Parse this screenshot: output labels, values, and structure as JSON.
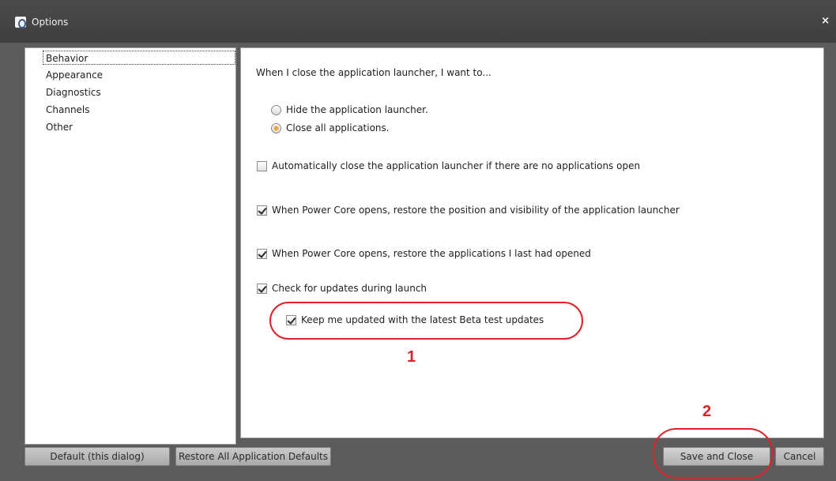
{
  "window": {
    "title": "Options",
    "close_glyph": "×",
    "icon": "app-icon"
  },
  "nav": {
    "items": [
      {
        "label": "Behavior",
        "selected": true
      },
      {
        "label": "Appearance",
        "selected": false
      },
      {
        "label": "Diagnostics",
        "selected": false
      },
      {
        "label": "Channels",
        "selected": false
      },
      {
        "label": "Other",
        "selected": false
      }
    ]
  },
  "content": {
    "prompt": "When I close the application launcher, I want to...",
    "radios": [
      {
        "label": "Hide the application launcher.",
        "checked": false
      },
      {
        "label": "Close all applications.",
        "checked": true
      }
    ],
    "checkboxes": [
      {
        "label": "Automatically close the application launcher if there are no applications open",
        "checked": false
      },
      {
        "label": "When Power Core opens, restore the position and visibility of the application launcher",
        "checked": true
      },
      {
        "label": "When Power Core opens, restore the applications I last had opened",
        "checked": true
      },
      {
        "label": "Check for updates during launch",
        "checked": true
      },
      {
        "label": "Keep me updated with the latest Beta test updates",
        "checked": true
      }
    ]
  },
  "annotations": {
    "one": "1",
    "two": "2",
    "color": "#e0212a"
  },
  "buttons": {
    "default_dialog": "Default (this dialog)",
    "restore_all": "Restore All Application Defaults",
    "save_close": "Save and Close",
    "cancel": "Cancel"
  }
}
